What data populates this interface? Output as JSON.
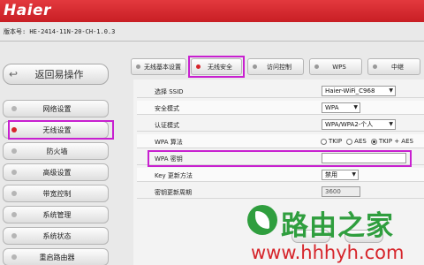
{
  "header": {
    "logo": "Haier"
  },
  "version": "版本号: HE-2414-11N-20-CH-1.0.3",
  "sidebar": {
    "back_label": "返回易操作",
    "items": [
      {
        "label": "网络设置"
      },
      {
        "label": "无线设置"
      },
      {
        "label": "防火墙"
      },
      {
        "label": "高级设置"
      },
      {
        "label": "带宽控制"
      },
      {
        "label": "系统管理"
      },
      {
        "label": "系统状态"
      },
      {
        "label": "重启路由器"
      }
    ],
    "active_index": 1
  },
  "tabs": [
    {
      "label": "无线基本设置"
    },
    {
      "label": "无线安全"
    },
    {
      "label": "访问控制"
    },
    {
      "label": "WPS"
    },
    {
      "label": "中继"
    }
  ],
  "active_tab": 1,
  "form": {
    "ssid": {
      "label": "选择 SSID",
      "value": "Haier-WiFi_C968"
    },
    "security_mode": {
      "label": "安全模式",
      "value": "WPA"
    },
    "auth_mode": {
      "label": "认证模式",
      "value": "WPA/WPA2-个人"
    },
    "wpa_algo": {
      "label": "WPA 算法",
      "options": [
        "TKIP",
        "AES",
        "TKIP + AES"
      ],
      "selected": "TKIP + AES"
    },
    "wpa_key": {
      "label": "WPA 密钥",
      "value": ""
    },
    "key_update": {
      "label": "Key 更新方法",
      "value": "禁用"
    },
    "key_period": {
      "label": "密钥更新周期",
      "value": "3600"
    }
  },
  "watermark": {
    "text": "路由之家",
    "url": "www.hhhyh.com"
  },
  "colors": {
    "header": "#d6242a",
    "highlight": "#c820d0",
    "watermark_green": "#2f9e3e",
    "watermark_red": "#d6242a"
  }
}
